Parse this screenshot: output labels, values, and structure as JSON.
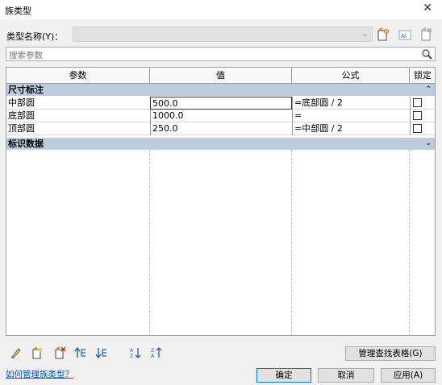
{
  "window": {
    "title": "族类型",
    "close_glyph": "✕"
  },
  "type_row": {
    "label": "类型名称(Y)：",
    "selected_value": ""
  },
  "toolbar_icons": [
    "new-type-icon",
    "rename-type-icon",
    "delete-type-icon"
  ],
  "search": {
    "placeholder": "搜索参数"
  },
  "table": {
    "headers": {
      "param": "参数",
      "value": "值",
      "formula": "公式",
      "lock": "锁定"
    },
    "groups": [
      {
        "label": "尺寸标注",
        "expanded": true,
        "rows": [
          {
            "param": "中部圆",
            "value": "500.0",
            "formula": "=底部圆 / 2",
            "locked": false,
            "active": true
          },
          {
            "param": "底部圆",
            "value": "1000.0",
            "formula": "=",
            "locked": false,
            "active": false
          },
          {
            "param": "顶部圆",
            "value": "250.0",
            "formula": "=中部圆 / 2",
            "locked": false,
            "active": false
          }
        ]
      },
      {
        "label": "标识数据",
        "expanded": false,
        "rows": []
      }
    ],
    "collapse_glyph": "⌃",
    "expand_glyph": "⌄"
  },
  "bottom_icons": [
    "edit-parameter-icon",
    "new-parameter-icon",
    "delete-parameter-icon",
    "move-up-icon",
    "move-down-icon",
    "sort-ascending-icon",
    "sort-descending-icon"
  ],
  "buttons": {
    "lookup_tables": "管理查找表格(G)",
    "ok": "确定",
    "cancel": "取消",
    "apply": "应用(A)"
  },
  "link": "如何管理族类型？",
  "colors": {
    "group_header": "#bcccdf",
    "link": "#0a55c5",
    "dialog_bg": "#f0f0f0"
  }
}
